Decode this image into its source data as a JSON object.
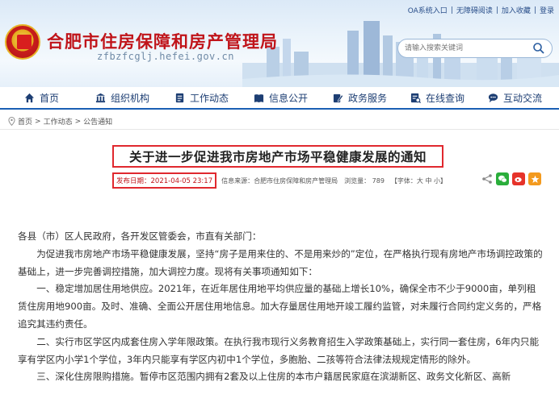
{
  "header": {
    "title": "合肥市住房保障和房产管理局",
    "domain": "zfbzfcglj.hefei.gov.cn",
    "top_links": [
      "OA系统入口",
      "无障碍阅读",
      "加入收藏",
      "登录"
    ],
    "search_placeholder": "请输入搜索关键词"
  },
  "nav": {
    "items": [
      {
        "label": "首页",
        "icon": "home-icon"
      },
      {
        "label": "组织机构",
        "icon": "building-icon"
      },
      {
        "label": "工作动态",
        "icon": "document-icon"
      },
      {
        "label": "信息公开",
        "icon": "book-icon"
      },
      {
        "label": "政务服务",
        "icon": "edit-icon"
      },
      {
        "label": "在线查询",
        "icon": "query-icon"
      },
      {
        "label": "互动交流",
        "icon": "chat-icon"
      }
    ]
  },
  "breadcrumb": {
    "items": [
      "首页",
      "工作动态",
      "公告通知"
    ],
    "separator": ">"
  },
  "article": {
    "title": "关于进一步促进我市房地产市场平稳健康发展的通知",
    "publish_date": "发布日期：2021-04-05 23:17",
    "source": "信息来源：合肥市住房保障和房产管理局",
    "views": "浏览量： 789",
    "font_size": "【字体：大 中 小】",
    "paragraphs": [
      "各县（市）区人民政府，各开发区管委会，市直有关部门：",
      "为促进我市房地产市场平稳健康发展，坚持“房子是用来住的、不是用来炒的”定位，在严格执行现有房地产市场调控政策的基础上，进一步完善调控措施，加大调控力度。现将有关事项通知如下：",
      "一、稳定增加居住用地供应。2021年，在近年居住用地平均供应量的基础上增长10%，确保全市不少于9000亩，单列租赁住房用地900亩。及时、准确、全面公开居住用地信息。加大存量居住用地开竣工履约监管，对未履行合同约定义务的，严格追究其违约责任。",
      "二、实行市区学区内成套住房入学年限政策。在执行我市现行义务教育招生入学政策基础上，实行同一套住房，6年内只能享有学区内小学1个学位，3年内只能享有学区内初中1个学位，多胞胎、二孩等符合法律法规规定情形的除外。",
      "三、深化住房限购措施。暂停市区范围内拥有2套及以上住房的本市户籍居民家庭在滨湖新区、政务文化新区、高新"
    ]
  },
  "colors": {
    "brand_red": "#c0141a",
    "nav_blue": "#1d3e73",
    "highlight_red": "#e0282e"
  }
}
